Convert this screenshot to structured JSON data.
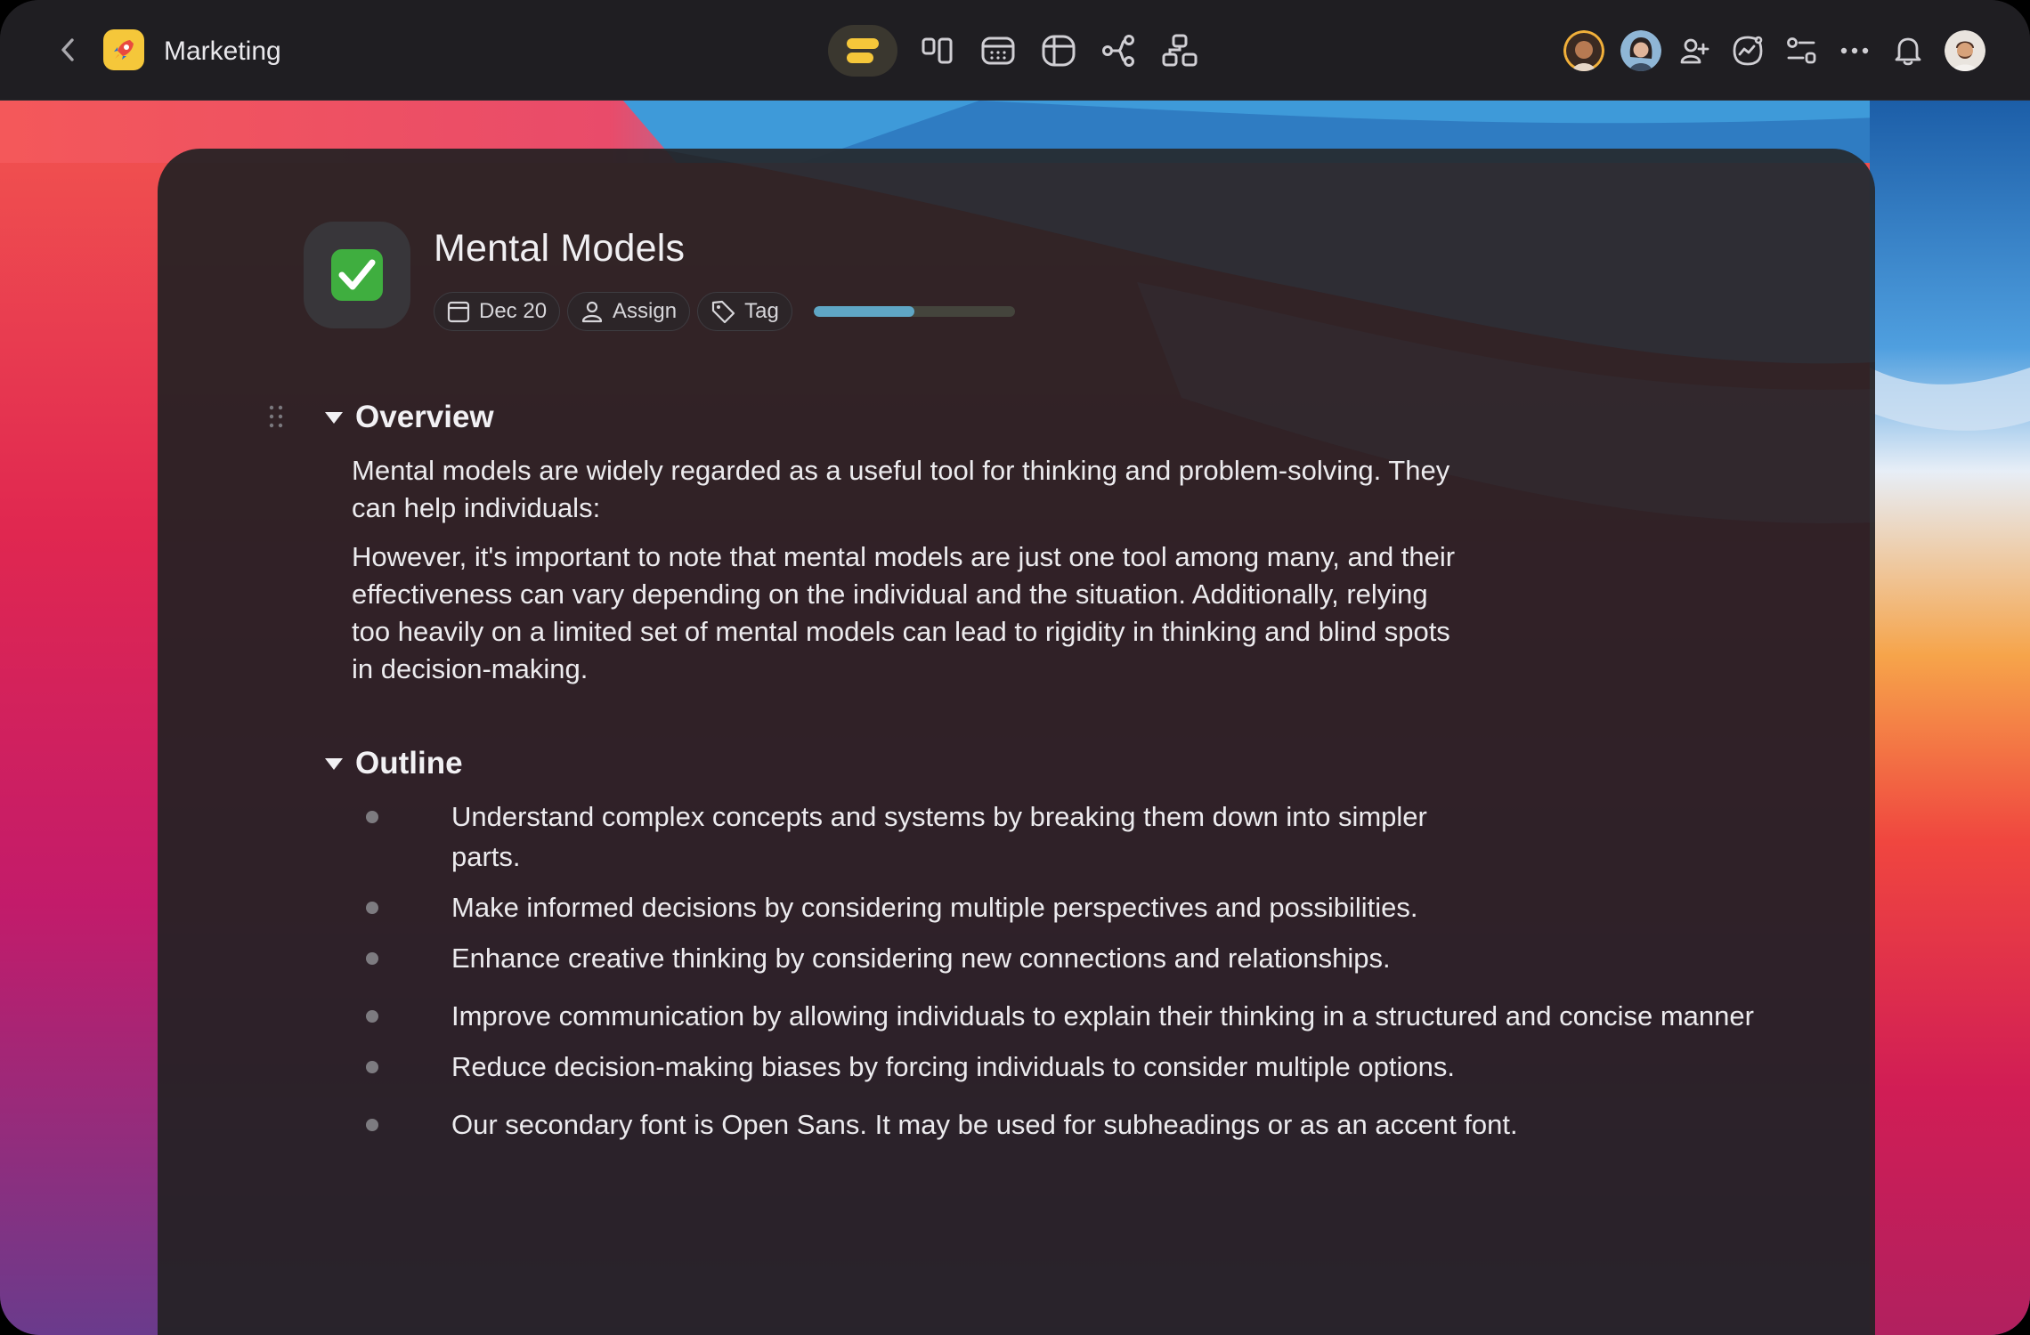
{
  "window": {
    "workspace_title": "Marketing",
    "app_icon": "rocket-icon",
    "back_icon": "chevron-left-icon"
  },
  "toolbar": {
    "views": [
      {
        "name": "list-view-icon",
        "active": true
      },
      {
        "name": "board-view-icon",
        "active": false
      },
      {
        "name": "calendar-view-icon",
        "active": false
      },
      {
        "name": "table-view-icon",
        "active": false
      },
      {
        "name": "mindmap-view-icon",
        "active": false
      },
      {
        "name": "org-view-icon",
        "active": false
      }
    ],
    "right": [
      "avatar-1",
      "avatar-2",
      "add-member-icon",
      "activity-icon",
      "filter-settings-icon",
      "more-icon",
      "notification-bell-icon",
      "user-avatar"
    ]
  },
  "document": {
    "icon": "check-mark-button-icon",
    "title": "Mental Models",
    "due_date": "Dec 20",
    "assign_label": "Assign",
    "tag_label": "Tag",
    "progress": 0.5
  },
  "overview": {
    "heading": "Overview",
    "para1": "Mental models are widely regarded as a useful tool for thinking and problem-solving. They can help individuals:",
    "para2": "However, it's important to note that mental models are just one tool among many, and their effectiveness can vary depending on the individual and the situation. Additionally, relying too heavily on a limited set of mental models can lead to rigidity in thinking and blind spots in decision-making."
  },
  "outline": {
    "heading": "Outline",
    "items": [
      "Understand complex concepts and systems by breaking them down into simpler parts.",
      "Make informed decisions by considering multiple perspectives and possibilities.",
      "Enhance creative thinking by considering new connections and relationships.",
      "Improve communication by allowing individuals to explain their thinking in a structured and concise manner",
      "Reduce decision-making biases by forcing individuals to consider multiple options.",
      "Our secondary font is Open Sans. It may be used for subheadings or as an accent font."
    ]
  },
  "colors": {
    "accent_yellow": "#f5c73a",
    "progress_fill": "#5fa6c5",
    "card_bg": "#242124"
  }
}
